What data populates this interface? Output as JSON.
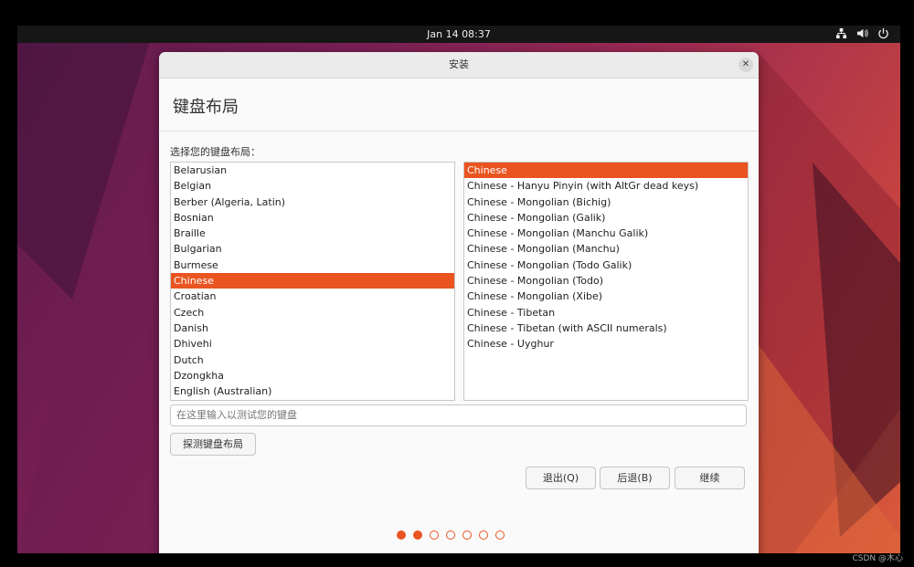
{
  "topbar": {
    "datetime": "Jan 14  08:37",
    "icons": [
      "network-icon",
      "volume-icon",
      "power-icon"
    ]
  },
  "window": {
    "title": "安装",
    "close_glyph": "✕",
    "heading": "键盘布局",
    "prompt": "选择您的键盘布局：",
    "layouts": [
      {
        "label": "Belarusian"
      },
      {
        "label": "Belgian"
      },
      {
        "label": "Berber (Algeria, Latin)"
      },
      {
        "label": "Bosnian"
      },
      {
        "label": "Braille"
      },
      {
        "label": "Bulgarian"
      },
      {
        "label": "Burmese"
      },
      {
        "label": "Chinese"
      },
      {
        "label": "Croatian"
      },
      {
        "label": "Czech"
      },
      {
        "label": "Danish"
      },
      {
        "label": "Dhivehi"
      },
      {
        "label": "Dutch"
      },
      {
        "label": "Dzongkha"
      },
      {
        "label": "English (Australian)"
      }
    ],
    "selected_layout": "Chinese",
    "variants": [
      {
        "label": "Chinese"
      },
      {
        "label": "Chinese - Hanyu Pinyin (with AltGr dead keys)"
      },
      {
        "label": "Chinese - Mongolian (Bichig)"
      },
      {
        "label": "Chinese - Mongolian (Galik)"
      },
      {
        "label": "Chinese - Mongolian (Manchu Galik)"
      },
      {
        "label": "Chinese - Mongolian (Manchu)"
      },
      {
        "label": "Chinese - Mongolian (Todo Galik)"
      },
      {
        "label": "Chinese - Mongolian (Todo)"
      },
      {
        "label": "Chinese - Mongolian (Xibe)"
      },
      {
        "label": "Chinese - Tibetan"
      },
      {
        "label": "Chinese - Tibetan (with ASCII numerals)"
      },
      {
        "label": "Chinese - Uyghur"
      }
    ],
    "selected_variant": "Chinese",
    "test_placeholder": "在这里输入以测试您的键盘",
    "test_value": "",
    "detect_label": "探测键盘布局",
    "quit_label": "退出(Q)",
    "back_label": "后退(B)",
    "continue_label": "继续",
    "progress": {
      "total_steps": 7,
      "completed_steps": 2
    }
  },
  "accent_color": "#e95420",
  "watermark": "CSDN @木心"
}
